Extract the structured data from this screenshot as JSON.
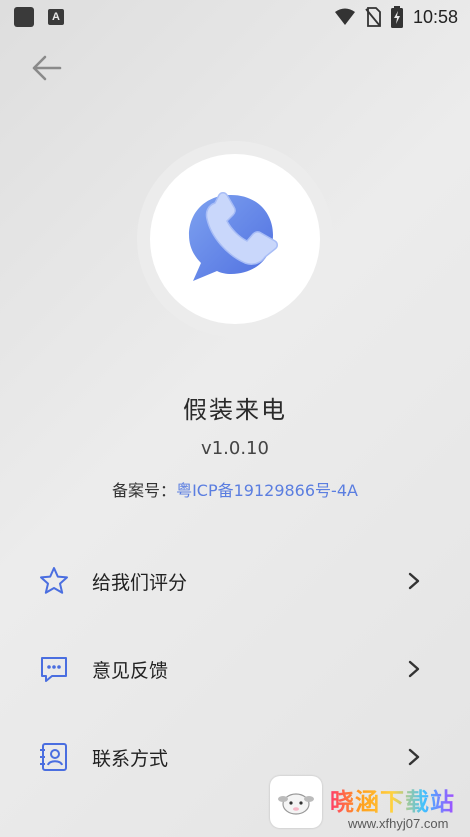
{
  "status_bar": {
    "time": "10:58",
    "notification_icon": "A"
  },
  "header": {
    "back_icon": "arrow-left-icon"
  },
  "app": {
    "name": "假装来电",
    "version": "v1.0.10",
    "icp_label": "备案号：",
    "icp_number": "粤ICP备19129866号-4A"
  },
  "menu": {
    "items": [
      {
        "label": "给我们评分",
        "icon": "star-icon"
      },
      {
        "label": "意见反馈",
        "icon": "feedback-icon"
      },
      {
        "label": "联系方式",
        "icon": "contact-card-icon"
      }
    ]
  },
  "watermark": {
    "title": "晓涵下载站",
    "url": "www.xfhyj07.com"
  },
  "colors": {
    "accent": "#5b7ee0",
    "icon_blue": "#4a6ee0",
    "background": "#e6e6e6"
  }
}
